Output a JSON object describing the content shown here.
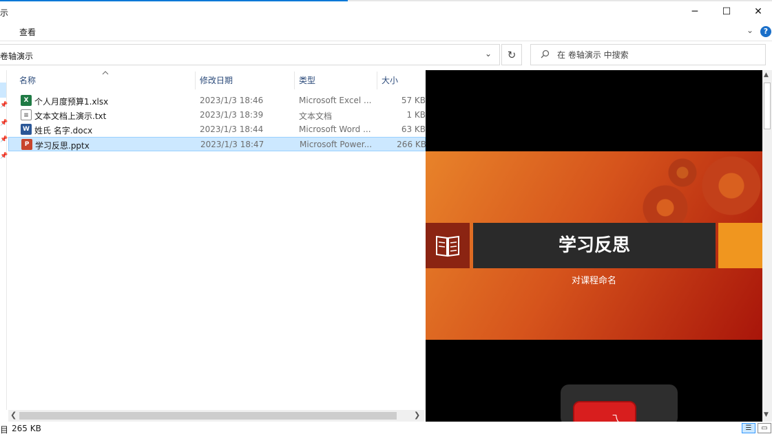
{
  "window": {
    "title": "示",
    "minimize_glyph": "─",
    "maximize_glyph": "☐",
    "close_glyph": "✕"
  },
  "ribbon": {
    "tab_view": "查看",
    "expand_glyph": "⌄",
    "help_glyph": "?"
  },
  "address": {
    "path": "卷轴演示",
    "dropdown_glyph": "⌄",
    "refresh_glyph": "↻"
  },
  "search": {
    "icon": "search-icon",
    "placeholder": "在 卷轴演示 中搜索"
  },
  "columns": {
    "name": "名称",
    "date": "修改日期",
    "type": "类型",
    "size": "大小"
  },
  "files": [
    {
      "icon": "excel-file-icon",
      "badge": "X",
      "name": "个人月度预算1.xlsx",
      "date": "2023/1/3 18:46",
      "type": "Microsoft Excel ...",
      "size": "57 KB"
    },
    {
      "icon": "text-file-icon",
      "badge": "≡",
      "name": "文本文档上演示.txt",
      "date": "2023/1/3 18:39",
      "type": "文本文档",
      "size": "1 KB"
    },
    {
      "icon": "word-file-icon",
      "badge": "W",
      "name": "姓氏 名字.docx",
      "date": "2023/1/3 18:44",
      "type": "Microsoft Word ...",
      "size": "63 KB"
    },
    {
      "icon": "powerpoint-file-icon",
      "badge": "P",
      "name": "学习反思.pptx",
      "date": "2023/1/3 18:47",
      "type": "Microsoft Power...",
      "size": "266 KB"
    }
  ],
  "selected_index": 3,
  "preview": {
    "slide_title": "学习反思",
    "slide_subtitle": "对课程命名",
    "logo_glyph": "乁"
  },
  "status": {
    "prefix": "目",
    "selection_size": "265 KB"
  },
  "colors": {
    "accent": "#0078d7",
    "selection": "#cce8ff",
    "slide_orange": "#e8832a",
    "slide_red": "#a8150a",
    "title_band": "#2a2a2a"
  }
}
